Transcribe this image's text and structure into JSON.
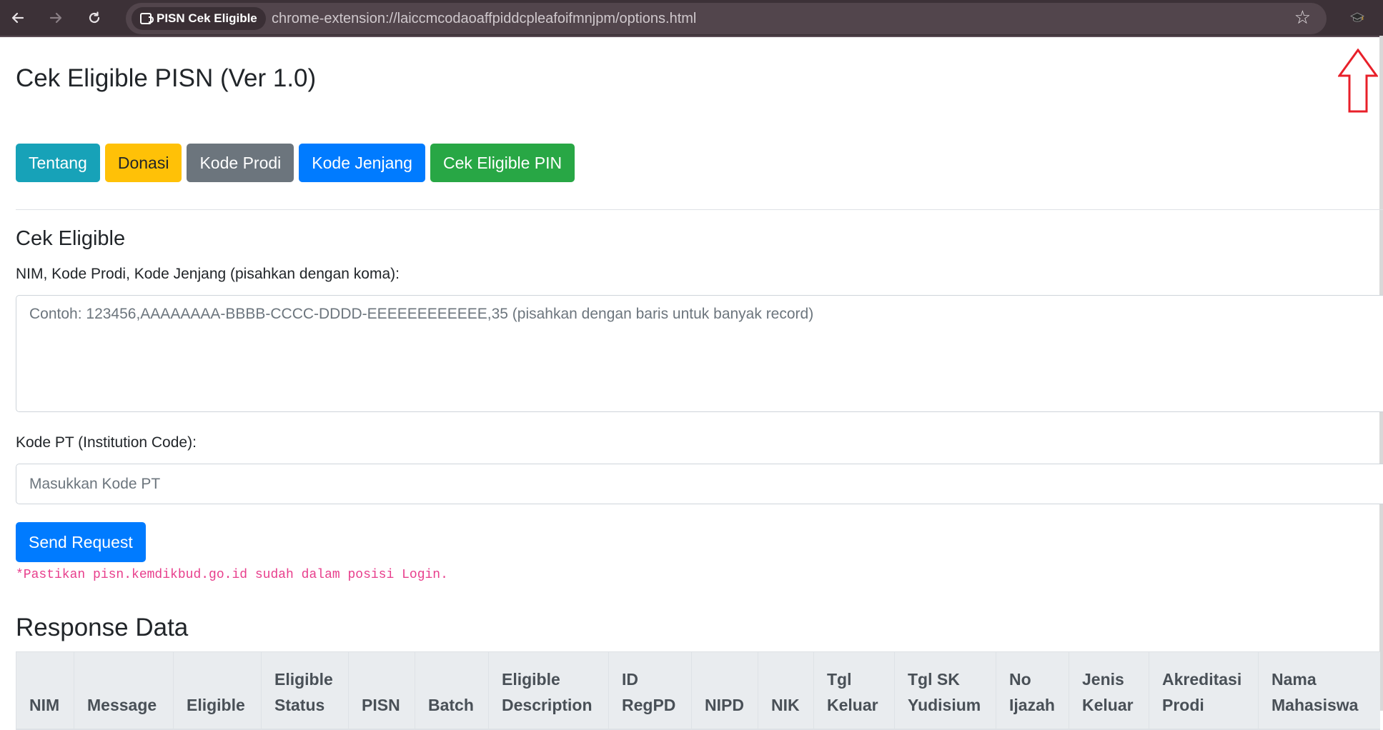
{
  "browser": {
    "back_icon": "arrow-left-icon",
    "forward_icon": "arrow-right-icon",
    "reload_icon": "reload-icon",
    "site_chip_label": "PISN Cek Eligible",
    "url": "chrome-extension://laiccmcodaoaffpiddcpleafoifmnjpm/options.html",
    "bookmark_icon": "star-icon",
    "extension_icon": "graduation-cap-icon",
    "annotation_icon": "red-up-arrow-icon"
  },
  "page": {
    "title": "Cek Eligible PISN (Ver 1.0)",
    "tabs": [
      {
        "label": "Tentang"
      },
      {
        "label": "Donasi"
      },
      {
        "label": "Kode Prodi"
      },
      {
        "label": "Kode Jenjang"
      },
      {
        "label": "Cek Eligible PIN"
      }
    ],
    "section_title": "Cek Eligible",
    "records_label": "NIM, Kode Prodi, Kode Jenjang (pisahkan dengan koma):",
    "records_placeholder": "Contoh: 123456,AAAAAAAA-BBBB-CCCC-DDDD-EEEEEEEEEEEE,35 (pisahkan dengan baris untuk banyak record)",
    "kode_pt_label": "Kode PT (Institution Code):",
    "kode_pt_placeholder": "Masukkan Kode PT",
    "send_label": "Send Request",
    "note": "*Pastikan pisn.kemdikbud.go.id sudah dalam posisi Login.",
    "response_title": "Response Data",
    "table_headers": [
      {
        "line1": "",
        "line2": "NIM"
      },
      {
        "line1": "",
        "line2": "Message"
      },
      {
        "line1": "",
        "line2": "Eligible"
      },
      {
        "line1": "Eligible",
        "line2": "Status"
      },
      {
        "line1": "",
        "line2": "PISN"
      },
      {
        "line1": "",
        "line2": "Batch"
      },
      {
        "line1": "Eligible",
        "line2": "Description"
      },
      {
        "line1": "ID",
        "line2": "RegPD"
      },
      {
        "line1": "",
        "line2": "NIPD"
      },
      {
        "line1": "",
        "line2": "NIK"
      },
      {
        "line1": "Tgl",
        "line2": "Keluar"
      },
      {
        "line1": "Tgl SK",
        "line2": "Yudisium"
      },
      {
        "line1": "No",
        "line2": "Ijazah"
      },
      {
        "line1": "Jenis",
        "line2": "Keluar"
      },
      {
        "line1": "Akreditasi",
        "line2": "Prodi"
      },
      {
        "line1": "Nama",
        "line2": "Mahasiswa"
      }
    ]
  }
}
